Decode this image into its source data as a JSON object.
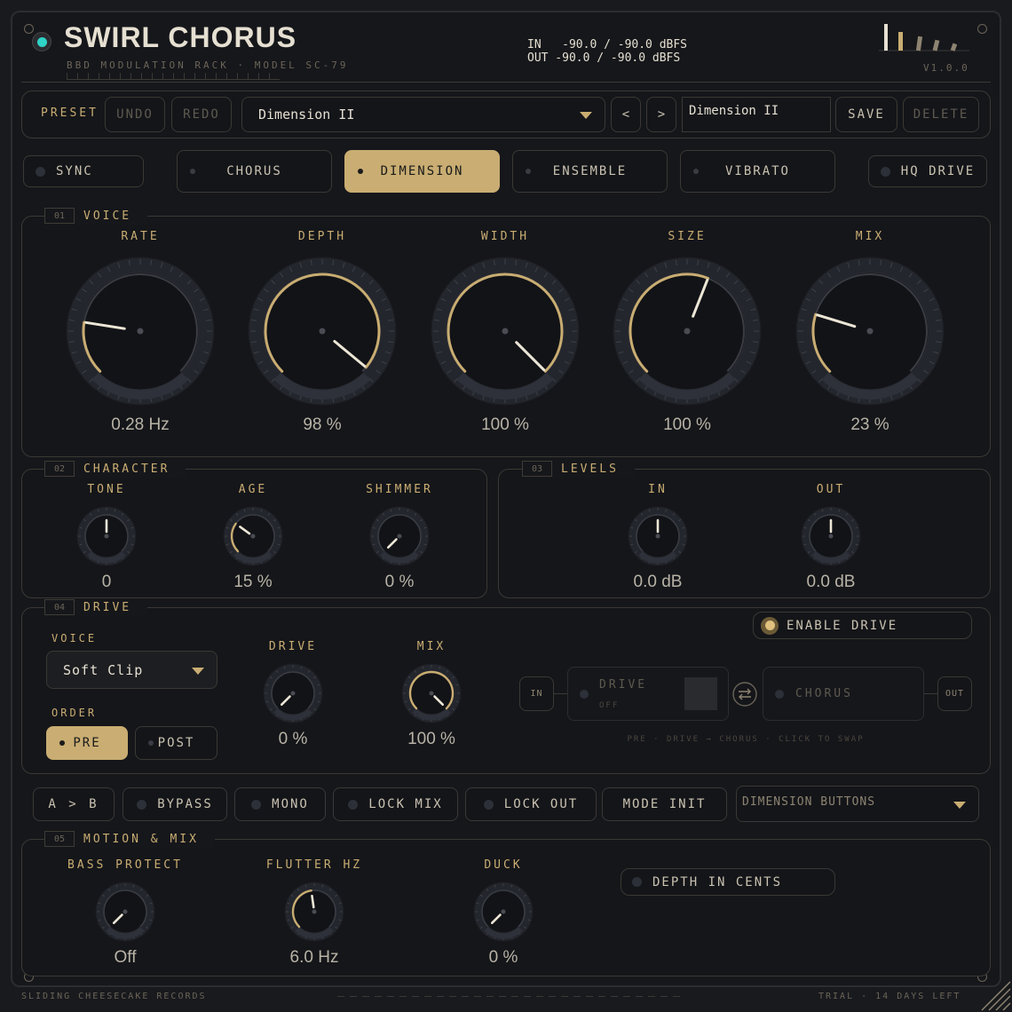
{
  "header": {
    "title": "SWIRL CHORUS",
    "subtitle": "BBD MODULATION RACK · MODEL SC-79",
    "meter_in": "IN   -90.0 / -90.0 dBFS",
    "meter_out": "OUT -90.0 / -90.0 dBFS",
    "version": "V1.0.0"
  },
  "preset_bar": {
    "preset_label": "PRESET",
    "undo": "UNDO",
    "redo": "REDO",
    "preset_select": "Dimension II",
    "prev": "<",
    "next": ">",
    "name_field": "Dimension II",
    "save": "SAVE",
    "delete": "DELETE"
  },
  "mode_row": {
    "sync": "SYNC",
    "modes": [
      "CHORUS",
      "DIMENSION",
      "ENSEMBLE",
      "VIBRATO"
    ],
    "active_mode": "DIMENSION",
    "hq_drive": "HQ DRIVE"
  },
  "voice": {
    "num": "01",
    "name": "VOICE",
    "knobs": [
      {
        "label": "RATE",
        "value": "0.28 Hz",
        "level": 0.2
      },
      {
        "label": "DEPTH",
        "value": "98 %",
        "level": 0.98
      },
      {
        "label": "WIDTH",
        "value": "100 %",
        "level": 1.0
      },
      {
        "label": "SIZE",
        "value": "100 %",
        "level": 0.58
      },
      {
        "label": "MIX",
        "value": "23 %",
        "level": 0.23
      }
    ]
  },
  "character": {
    "num": "02",
    "name": "CHARACTER",
    "knobs": [
      {
        "label": "TONE",
        "value": "0",
        "level": 0.5
      },
      {
        "label": "AGE",
        "value": "15 %",
        "level": 0.3
      },
      {
        "label": "SHIMMER",
        "value": "0 %",
        "level": 0.0
      }
    ]
  },
  "levels": {
    "num": "03",
    "name": "LEVELS",
    "knobs": [
      {
        "label": "IN",
        "value": "0.0 dB",
        "level": 0.5
      },
      {
        "label": "OUT",
        "value": "0.0 dB",
        "level": 0.5
      }
    ]
  },
  "drive": {
    "num": "04",
    "name": "DRIVE",
    "voice_label": "VOICE",
    "voice_select": "Soft Clip",
    "order_label": "ORDER",
    "pre": "PRE",
    "post": "POST",
    "knobs": [
      {
        "label": "DRIVE",
        "value": "0 %",
        "level": 0.0
      },
      {
        "label": "MIX",
        "value": "100 %",
        "level": 1.0
      }
    ],
    "enable": "ENABLE DRIVE",
    "chain_in": "IN",
    "chain_drive": "DRIVE",
    "chain_drive_state": "OFF",
    "chain_chorus": "CHORUS",
    "chain_out": "OUT",
    "chain_hint": "PRE · DRIVE → CHORUS · CLICK TO SWAP"
  },
  "utility_row": {
    "ab": "A > B",
    "bypass": "BYPASS",
    "mono": "MONO",
    "lock_mix": "LOCK MIX",
    "lock_out": "LOCK OUT",
    "mode_init": "MODE INIT",
    "dimension_select": "DIMENSION BUTTONS"
  },
  "motion": {
    "num": "05",
    "name": "MOTION & MIX",
    "knobs": [
      {
        "label": "BASS PROTECT",
        "value": "Off",
        "level": 0.0
      },
      {
        "label": "FLUTTER HZ",
        "value": "6.0 Hz",
        "level": 0.47
      },
      {
        "label": "DUCK",
        "value": "0 %",
        "level": 0.0
      }
    ],
    "depth_in_cents": "DEPTH IN CENTS"
  },
  "footer": {
    "left": "SLIDING CHEESECAKE RECORDS",
    "right": "TRIAL · 14 DAYS LEFT"
  },
  "colors": {
    "accent": "#c9ad72",
    "background": "#16171b",
    "led_on": "#2ed3c6"
  }
}
